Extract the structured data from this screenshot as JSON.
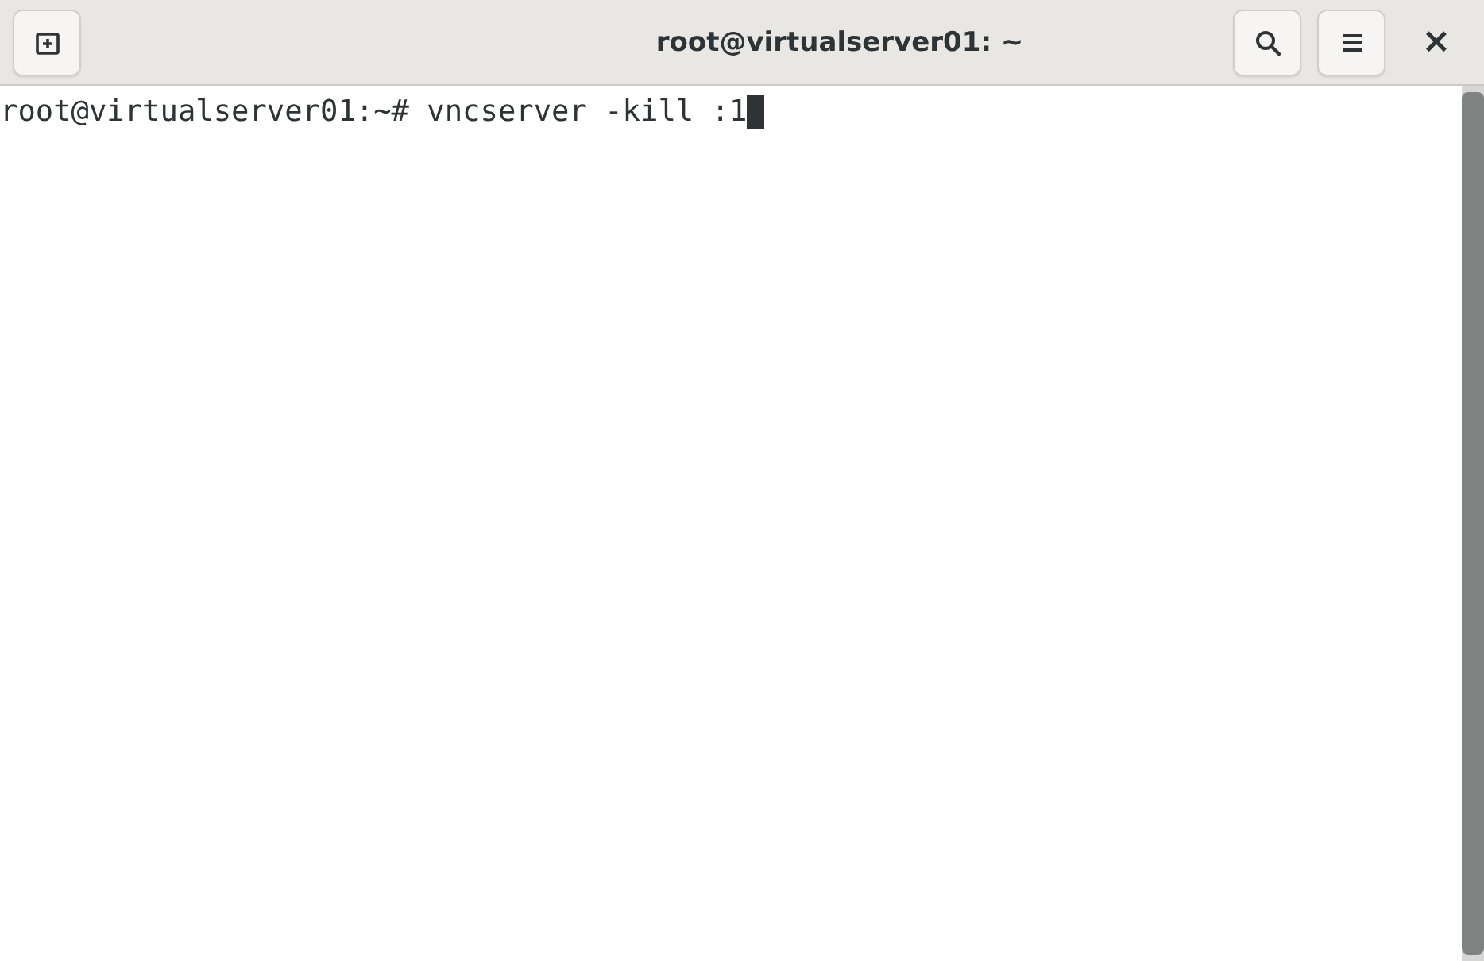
{
  "window": {
    "title": "root@virtualserver01: ~"
  },
  "header_buttons": [
    {
      "kind": "search"
    },
    {
      "kind": "menu"
    }
  ],
  "close_button": {
    "label": "×"
  },
  "terminal": {
    "lines": [
      {
        "text": "root@virtualserver01:~# vncserver -kill :1",
        "cursor": true
      }
    ]
  }
}
